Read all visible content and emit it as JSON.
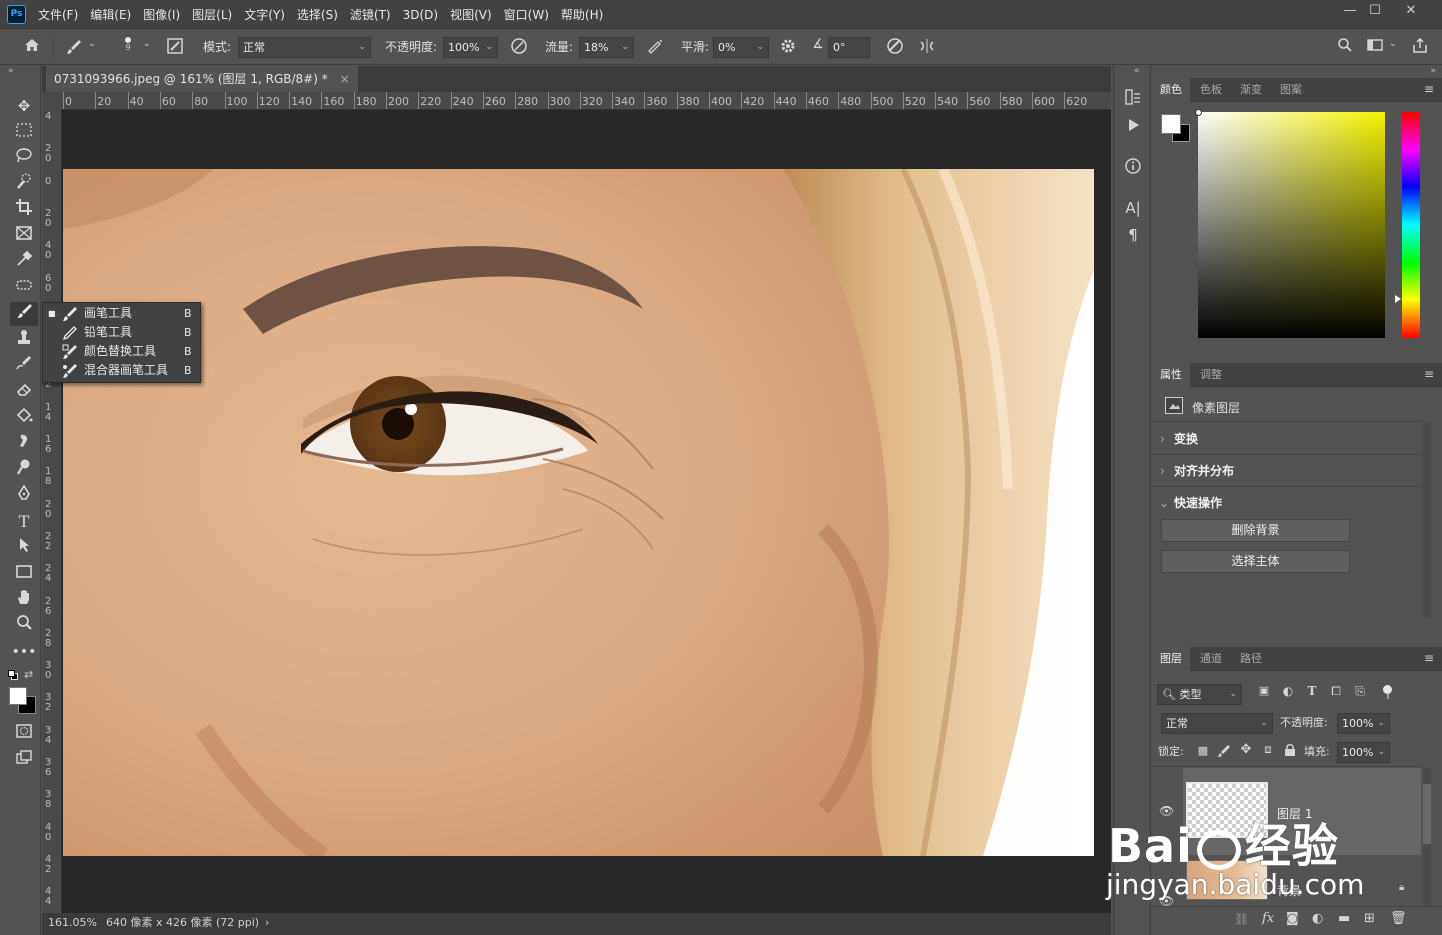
{
  "app": {
    "logo": "Ps"
  },
  "menu": [
    "文件(F)",
    "编辑(E)",
    "图像(I)",
    "图层(L)",
    "文字(Y)",
    "选择(S)",
    "滤镜(T)",
    "3D(D)",
    "视图(V)",
    "窗口(W)",
    "帮助(H)"
  ],
  "window_controls": {
    "minimize": "—",
    "restore": "☐",
    "close": "✕"
  },
  "options": {
    "brush_size": "9",
    "mode_label": "模式:",
    "mode_value": "正常",
    "opacity_label": "不透明度:",
    "opacity_value": "100%",
    "flow_label": "流量:",
    "flow_value": "18%",
    "smoothing_label": "平滑:",
    "smoothing_value": "0%",
    "angle_value": "0°"
  },
  "document": {
    "tab_title": "0731093966.jpeg @ 161% (图层 1, RGB/8#) *",
    "close": "×"
  },
  "ruler_h": [
    "0",
    "20",
    "40",
    "60",
    "80",
    "100",
    "120",
    "140",
    "160",
    "180",
    "200",
    "220",
    "240",
    "260",
    "280",
    "300",
    "320",
    "340",
    "360",
    "380",
    "400",
    "420",
    "440",
    "460",
    "480",
    "500",
    "520",
    "540",
    "560",
    "580",
    "600",
    "620"
  ],
  "ruler_v": [
    "4",
    "2 0",
    "0",
    "2 0",
    "4 0",
    "6 0",
    "8",
    "1 0",
    "1 2",
    "1 4",
    "1 6",
    "1 8",
    "2 0",
    "2 2",
    "2 4",
    "2 6",
    "2 8",
    "3 0",
    "3 2",
    "3 4",
    "3 6",
    "3 8",
    "4 0",
    "4 2",
    "4 4"
  ],
  "status": {
    "zoom": "161.05%",
    "info": "640 像素 x 426 像素 (72 ppi)",
    "arrow": "›"
  },
  "flyout": {
    "items": [
      {
        "label": "画笔工具",
        "key": "B",
        "icon": "brush-icon"
      },
      {
        "label": "铅笔工具",
        "key": "B",
        "icon": "pencil-icon"
      },
      {
        "label": "颜色替换工具",
        "key": "B",
        "icon": "color-replace-icon"
      },
      {
        "label": "混合器画笔工具",
        "key": "B",
        "icon": "mixer-brush-icon"
      }
    ]
  },
  "color_panel": {
    "tabs": [
      "颜色",
      "色板",
      "渐变",
      "图案"
    ]
  },
  "properties_panel": {
    "tabs": [
      "属性",
      "调整"
    ],
    "layer_type": "像素图层",
    "sections": [
      "变换",
      "对齐并分布",
      "快速操作"
    ],
    "buttons": [
      "删除背景",
      "选择主体"
    ]
  },
  "layers_panel": {
    "tabs": [
      "图层",
      "通道",
      "路径"
    ],
    "filter_label": "类型",
    "blend_mode": "正常",
    "opacity_label": "不透明度:",
    "opacity_value": "100%",
    "lock_label": "锁定:",
    "fill_label": "填充:",
    "fill_value": "100%",
    "layers": [
      {
        "name": "图层 1"
      },
      {
        "name": "背景"
      }
    ]
  },
  "watermark": {
    "brand": "Bai",
    "brand2": "经验",
    "url": "jingyan.baidu.com"
  },
  "colors": {
    "accent": "#31a8ff",
    "bg": "#535353",
    "canvas_bg": "#282828"
  }
}
